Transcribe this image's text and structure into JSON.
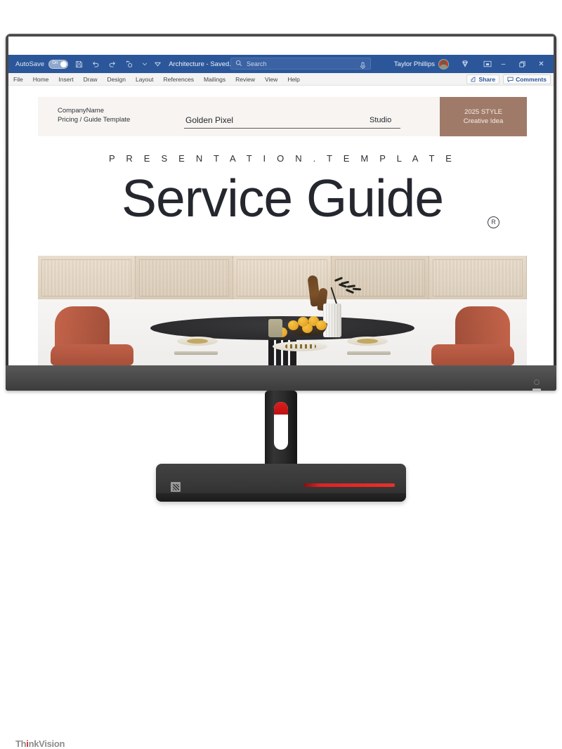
{
  "app": {
    "titlebar": {
      "autosave_label": "AutoSave",
      "autosave_state": "On",
      "document_name": "Architecture - Saved...",
      "account_name": "Taylor Phillips",
      "icons": [
        "save-icon",
        "undo-icon",
        "redo-icon",
        "touch-mode-icon",
        "customize-toolbar-caret",
        "ribbon-display-caret"
      ],
      "window_buttons": {
        "minimize": "–",
        "restore": "❐",
        "close": "✕"
      },
      "brand_color": "#2b579a"
    },
    "search": {
      "placeholder": "Search",
      "icon": "search-icon",
      "dictate_icon": "microphone-icon"
    },
    "ribbon": {
      "tabs": [
        "File",
        "Home",
        "Insert",
        "Draw",
        "Design",
        "Layout",
        "References",
        "Mailings",
        "Review",
        "View",
        "Help"
      ],
      "share_label": "Share",
      "comments_label": "Comments"
    }
  },
  "document": {
    "header": {
      "company_line1": "CompanyName",
      "company_line2": "Pricing / Guide Template",
      "brand_title": "Golden Pixel",
      "section_label": "Studio",
      "badge_line1": "2025 STYLE",
      "badge_line2": "Creative Idea",
      "badge_color": "#a07a68",
      "band_color": "#f7f4f2"
    },
    "kicker": "P R E S E N T A T I O N . T E M P L A T E",
    "title": "Service Guide",
    "trademark": "R",
    "photo": {
      "alt": "dining room with round black table, two terracotta chairs, fruit bowl and vase"
    }
  },
  "monitor": {
    "brand": "Th",
    "brand_dot": "i",
    "brand_rest": "nkVision",
    "power_icon": "power-button-icon",
    "bezel_color": "#3e3e3e",
    "accent_color": "#e02222"
  }
}
